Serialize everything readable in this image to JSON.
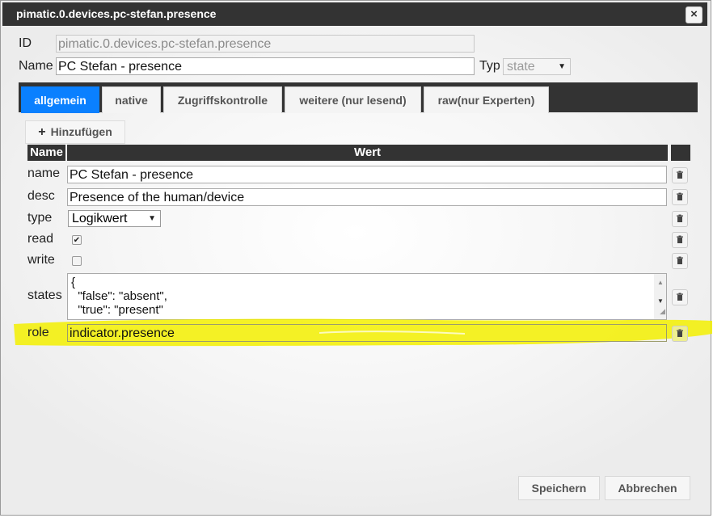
{
  "dialog": {
    "title": "pimatic.0.devices.pc-stefan.presence"
  },
  "header": {
    "id_label": "ID",
    "id_value": "pimatic.0.devices.pc-stefan.presence",
    "name_label": "Name",
    "name_value": "PC Stefan - presence",
    "type_label": "Typ",
    "type_value": "state"
  },
  "tabs": [
    {
      "label": "allgemein",
      "active": true
    },
    {
      "label": "native",
      "active": false
    },
    {
      "label": "Zugriffskontrolle",
      "active": false
    },
    {
      "label": "weitere (nur lesend)",
      "active": false
    },
    {
      "label": "raw(nur Experten)",
      "active": false
    }
  ],
  "add_button": {
    "label": "Hinzufügen",
    "icon": "plus-icon"
  },
  "table": {
    "headers": [
      "Name",
      "Wert"
    ],
    "rows": {
      "name": {
        "label": "name",
        "value": "PC Stefan - presence"
      },
      "desc": {
        "label": "desc",
        "value": "Presence of the human/device"
      },
      "type": {
        "label": "type",
        "value": "Logikwert"
      },
      "read": {
        "label": "read",
        "checked": true
      },
      "write": {
        "label": "write",
        "checked": false
      },
      "states": {
        "label": "states",
        "lines": [
          "{",
          "  \"false\": \"absent\",",
          "  \"true\": \"present\""
        ]
      },
      "role": {
        "label": "role",
        "value": "indicator.presence"
      }
    },
    "delete_icon": "trash-icon"
  },
  "footer": {
    "save_label": "Speichern",
    "cancel_label": "Abbrechen"
  },
  "colors": {
    "accent": "#0a80ff",
    "titlebar": "#333333",
    "highlight": "#f3f000"
  }
}
